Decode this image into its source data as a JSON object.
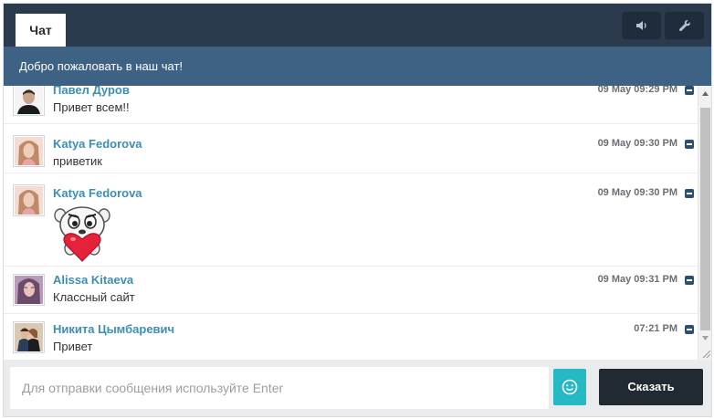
{
  "header": {
    "tab_label": "Чат",
    "sound_icon": "speaker-icon",
    "settings_icon": "wrench-icon"
  },
  "welcome_text": "Добро пожаловать в наш чат!",
  "messages": [
    {
      "author": "Павел Дуров",
      "text": "Привет всем!!",
      "time": "09 May 09:29 PM",
      "avatar_color": "#3a3a3a"
    },
    {
      "author": "Katya Fedorova",
      "text": "приветик",
      "time": "09 May 09:30 PM",
      "avatar_color": "#e0b7a5"
    },
    {
      "author": "Katya Fedorova",
      "text": "",
      "sticker": "heart-bear-sticker",
      "time": "09 May 09:30 PM",
      "avatar_color": "#e0b7a5"
    },
    {
      "author": "Alissa Kitaeva",
      "text": "Классный сайт",
      "time": "09 May 09:31 PM",
      "avatar_color": "#8a6f8e"
    },
    {
      "author": "Никита Цымбаревич",
      "text": "Привет",
      "time": "07:21 PM",
      "avatar_color": "#6b4e3d"
    }
  ],
  "input": {
    "placeholder": "Для отправки сообщения используйте Enter",
    "value": ""
  },
  "send_label": "Сказать",
  "colors": {
    "topbar": "#2b3a4c",
    "welcome_bar": "#3e6283",
    "author_name": "#3b8fb5",
    "emoji_button": "#25b9c4",
    "send_button": "#222a31"
  }
}
